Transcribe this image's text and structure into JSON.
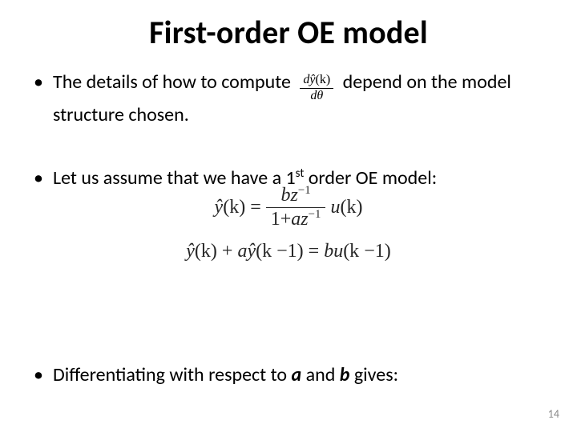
{
  "title": "First-order OE model",
  "bullets": {
    "b1a": "The details of how to compute",
    "b1b": "depend on the model structure chosen.",
    "b2a": "Let us assume that we have a 1",
    "b2sup": "st",
    "b2b": " order OE model:",
    "b3a": "Differentiating with respect to ",
    "b3b": " and ",
    "b3c": " gives:",
    "a": "a",
    "b": "b"
  },
  "frac_inline": {
    "num_a": "d",
    "num_b": "ŷ",
    "num_c": "(k)",
    "den_a": "d",
    "den_b": "θ"
  },
  "eq1": {
    "lhs_y": "ŷ",
    "lhs_k": "(k)",
    "eq": "=",
    "num_b": "b",
    "num_z": "z",
    "num_exp": "−1",
    "den_1": "1",
    "den_plus": "+",
    "den_a": "a",
    "den_z": "z",
    "den_exp": "−1",
    "rhs_u": "u",
    "rhs_k": "(k)"
  },
  "eq2": {
    "t1_y": "ŷ",
    "t1_k": "(k)",
    "plus1": "+",
    "a": "a",
    "t2_y": "ŷ",
    "t2_k": "(k",
    "minus1a": "−",
    "one1": "1)",
    "eq": "=",
    "b": "b",
    "u": "u",
    "uk": "(k",
    "minus1b": "−",
    "one2": "1)"
  },
  "page_number": "14"
}
